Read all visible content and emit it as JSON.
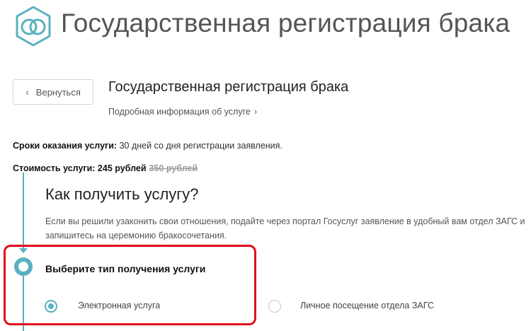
{
  "header": {
    "logo_icon": "interlocked-rings-icon",
    "title": "Государственная регистрация брака"
  },
  "toolbar": {
    "back_label": "Вернуться",
    "back_icon": "chevron-left-icon"
  },
  "service": {
    "title": "Государственная регистрация брака",
    "details_link": "Подробная информация об услуге",
    "details_icon": "chevron-right-icon"
  },
  "info": {
    "terms_label": "Сроки оказания услуги:",
    "terms_value": " 30 дней со дня регистрации заявления.",
    "cost_label": "Стоимость услуги: 245 рублей",
    "cost_old": "350 рублей"
  },
  "how": {
    "title": "Как получить услугу?",
    "description": "Если вы решили узаконить свои отношения, подайте через портал Госуслуг заявление в удобный вам отдел ЗАГС и запишитесь на церемонию бракосочетания."
  },
  "choose": {
    "title": "Выберите тип получения услуги",
    "options": [
      {
        "label": "Электронная услуга",
        "selected": true
      },
      {
        "label": "Личное посещение отдела ЗАГС",
        "selected": false
      }
    ]
  },
  "colors": {
    "accent": "#5ab0c0",
    "highlight": "#e0101c"
  }
}
